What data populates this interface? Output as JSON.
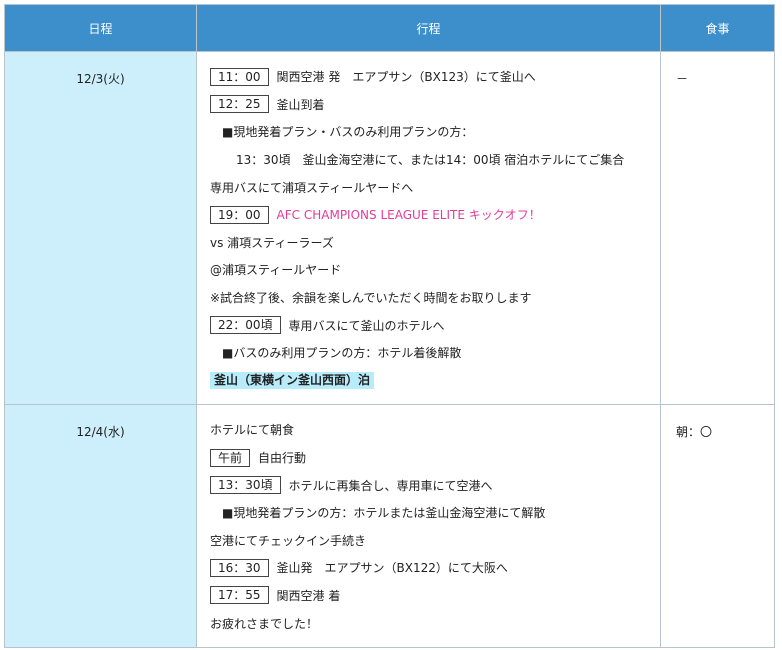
{
  "headers": {
    "date": "日程",
    "itinerary": "行程",
    "meals": "食事"
  },
  "days": [
    {
      "date": "12/3(火)",
      "meal": "－",
      "lines": [
        {
          "time": "11：00",
          "text": "関西空港 発　エアプサン（BX123）にて釜山へ"
        },
        {
          "time": "12：25",
          "text": "釜山到着"
        },
        {
          "text": "■現地発着プラン・バスのみ利用プランの方：",
          "indent": 1
        },
        {
          "text": "13：30頃　釜山金海空港にて、または14：00頃 宿泊ホテルにてご集合",
          "indent": 2
        },
        {
          "text": "専用バスにて浦項スティールヤードへ"
        },
        {
          "time": "19：00",
          "text": "AFC CHAMPIONS LEAGUE ELITE キックオフ！",
          "style": "pink"
        },
        {
          "text": "vs 浦項スティーラーズ"
        },
        {
          "text": "@浦項スティールヤード"
        },
        {
          "text": "※試合終了後、余韻を楽しんでいただく時間をお取りします"
        },
        {
          "time": "22：00頃",
          "text": "専用バスにて釜山のホテルへ"
        },
        {
          "text": "■バスのみ利用プランの方：ホテル着後解散",
          "indent": 1
        },
        {
          "text": "釜山（東横イン釜山西面）泊",
          "style": "highlight"
        }
      ]
    },
    {
      "date": "12/4(水)",
      "meal": "朝：〇",
      "lines": [
        {
          "text": "ホテルにて朝食"
        },
        {
          "time": "午前",
          "text": "自由行動"
        },
        {
          "time": "13：30頃",
          "text": "ホテルに再集合し、専用車にて空港へ"
        },
        {
          "text": "■現地発着プランの方：ホテルまたは釜山金海空港にて解散",
          "indent": 1
        },
        {
          "text": "空港にてチェックイン手続き"
        },
        {
          "time": "16：30",
          "text": "釜山発　エアプサン（BX122）にて大阪へ"
        },
        {
          "time": "17：55",
          "text": "関西空港 着"
        },
        {
          "text": "お疲れさまでした！"
        }
      ]
    }
  ]
}
